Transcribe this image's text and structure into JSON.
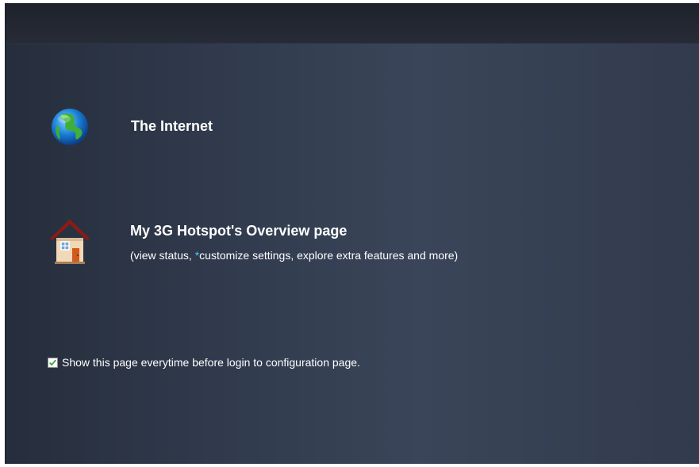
{
  "options": {
    "internet": {
      "title": "The Internet",
      "icon": "globe-icon"
    },
    "overview": {
      "title": "My 3G Hotspot's Overview page",
      "desc_before": "(view status, ",
      "desc_asterisk": "*",
      "desc_after": "customize settings, explore extra features and more)",
      "icon": "house-icon"
    }
  },
  "show_page": {
    "checked": true,
    "label": "Show this page everytime before login to configuration page."
  },
  "colors": {
    "background": "#323c4f",
    "topbar": "#1e222b",
    "text": "#ffffff",
    "asterisk": "#4fc3f7",
    "checkmark": "#2e9e3a"
  }
}
